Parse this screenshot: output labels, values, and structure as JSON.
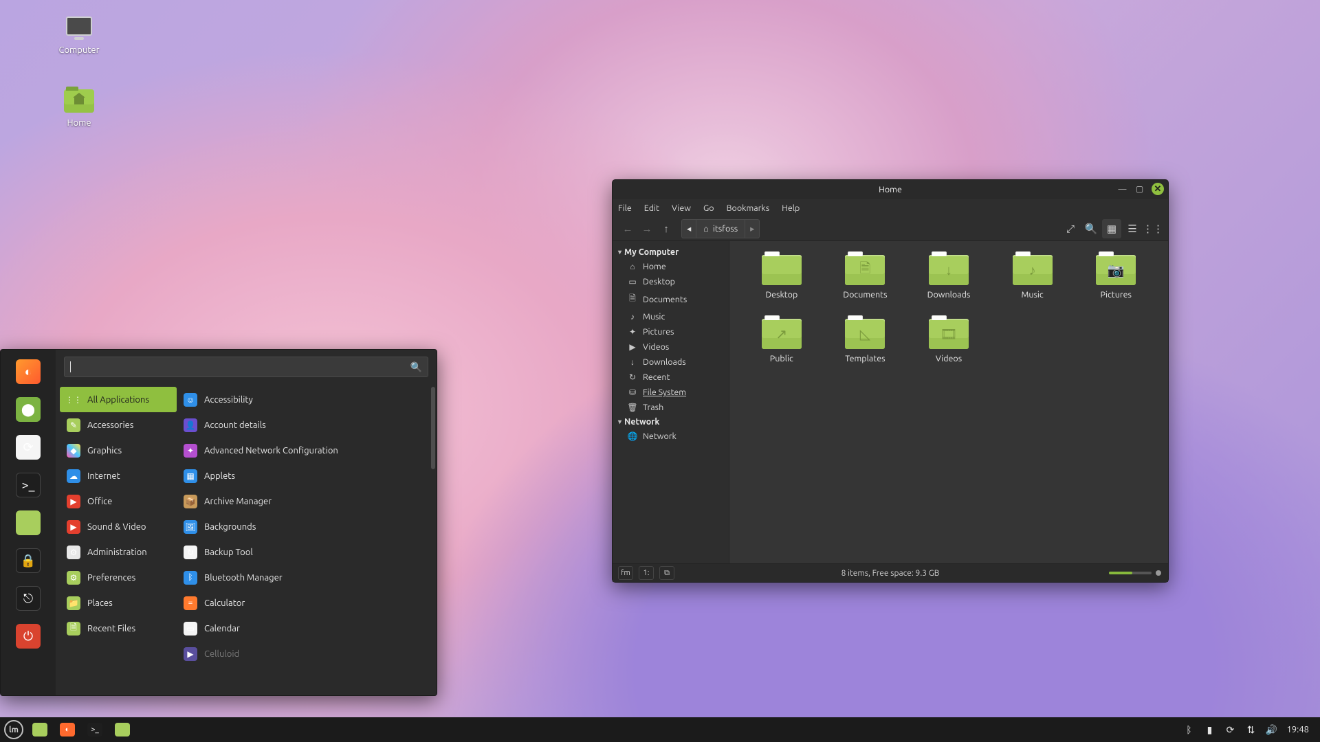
{
  "desktop_icons": {
    "computer": "Computer",
    "home": "Home"
  },
  "file_manager": {
    "title": "Home",
    "menu": [
      "File",
      "Edit",
      "View",
      "Go",
      "Bookmarks",
      "Help"
    ],
    "path_segments": {
      "home_icon": "home",
      "location": "itsfoss"
    },
    "sidebar": {
      "header1": "My Computer",
      "items1": [
        {
          "icon": "⌂",
          "label": "Home"
        },
        {
          "icon": "▭",
          "label": "Desktop"
        },
        {
          "icon": "🗎",
          "label": "Documents"
        },
        {
          "icon": "♪",
          "label": "Music"
        },
        {
          "icon": "✦",
          "label": "Pictures"
        },
        {
          "icon": "▶",
          "label": "Videos"
        },
        {
          "icon": "↓",
          "label": "Downloads"
        },
        {
          "icon": "↻",
          "label": "Recent"
        },
        {
          "icon": "⛁",
          "label": "File System",
          "underline": true
        },
        {
          "icon": "🗑",
          "label": "Trash"
        }
      ],
      "header2": "Network",
      "items2": [
        {
          "icon": "🌐",
          "label": "Network"
        }
      ]
    },
    "folders": [
      {
        "label": "Desktop",
        "glyph": ""
      },
      {
        "label": "Documents",
        "glyph": "🗎"
      },
      {
        "label": "Downloads",
        "glyph": "↓"
      },
      {
        "label": "Music",
        "glyph": "♪"
      },
      {
        "label": "Pictures",
        "glyph": "📷"
      },
      {
        "label": "Public",
        "glyph": "↗"
      },
      {
        "label": "Templates",
        "glyph": "◺"
      },
      {
        "label": "Videos",
        "glyph": "🎞"
      }
    ],
    "status": "8 items, Free space: 9.3 GB",
    "status_buttons": [
      "fm",
      "1:",
      "⧉"
    ]
  },
  "app_menu": {
    "search_placeholder": "",
    "favorites": [
      {
        "name": "firefox",
        "cls": "fav-ff",
        "glyph": "◐"
      },
      {
        "name": "software-manager",
        "cls": "fav-sw",
        "glyph": "⬤"
      },
      {
        "name": "update-manager",
        "cls": "fav-upd",
        "glyph": "⟳"
      },
      {
        "name": "terminal",
        "cls": "fav-term",
        "glyph": ">_"
      },
      {
        "name": "files",
        "cls": "fav-files",
        "glyph": ""
      },
      {
        "name": "lock",
        "cls": "fav-lock",
        "glyph": "🔒"
      },
      {
        "name": "logout",
        "cls": "fav-logout",
        "glyph": "⎋"
      },
      {
        "name": "shutdown",
        "cls": "fav-power",
        "glyph": "⏻"
      }
    ],
    "categories": [
      {
        "icon": "cic-all",
        "glyph": "⋮⋮",
        "label": "All Applications",
        "selected": true
      },
      {
        "icon": "cic-acc",
        "glyph": "✎",
        "label": "Accessories"
      },
      {
        "icon": "cic-gfx",
        "glyph": "◆",
        "label": "Graphics"
      },
      {
        "icon": "cic-net",
        "glyph": "☁",
        "label": "Internet"
      },
      {
        "icon": "cic-off",
        "glyph": "▶",
        "label": "Office"
      },
      {
        "icon": "cic-snd",
        "glyph": "▶",
        "label": "Sound & Video"
      },
      {
        "icon": "cic-adm",
        "glyph": "⚙",
        "label": "Administration"
      },
      {
        "icon": "cic-pref",
        "glyph": "⚙",
        "label": "Preferences"
      },
      {
        "icon": "cic-plc",
        "glyph": "📁",
        "label": "Places"
      },
      {
        "icon": "cic-rec",
        "glyph": "🗎",
        "label": "Recent Files"
      }
    ],
    "applications": [
      {
        "icon": "aic-acc",
        "glyph": "☺",
        "label": "Accessibility"
      },
      {
        "icon": "aic-acct",
        "glyph": "👤",
        "label": "Account details"
      },
      {
        "icon": "aic-net",
        "glyph": "✦",
        "label": "Advanced Network Configuration"
      },
      {
        "icon": "aic-app",
        "glyph": "▦",
        "label": "Applets"
      },
      {
        "icon": "aic-arch",
        "glyph": "📦",
        "label": "Archive Manager"
      },
      {
        "icon": "aic-bg",
        "glyph": "🖼",
        "label": "Backgrounds"
      },
      {
        "icon": "aic-bk",
        "glyph": "↻",
        "label": "Backup Tool"
      },
      {
        "icon": "aic-bt",
        "glyph": "ᛒ",
        "label": "Bluetooth Manager"
      },
      {
        "icon": "aic-calc",
        "glyph": "=",
        "label": "Calculator"
      },
      {
        "icon": "aic-cal",
        "glyph": "▭",
        "label": "Calendar"
      },
      {
        "icon": "aic-cell",
        "glyph": "▶",
        "label": "Celluloid",
        "dim": true
      }
    ]
  },
  "taskbar": {
    "launchers": [
      {
        "name": "menu",
        "glyph": "lm"
      },
      {
        "name": "files",
        "glyph": "",
        "color": "#a8ce5d"
      },
      {
        "name": "firefox",
        "glyph": "◐",
        "color": "#ff6a2e"
      },
      {
        "name": "terminal",
        "glyph": ">_",
        "color": "#1e1e1e"
      },
      {
        "name": "files-window",
        "glyph": "",
        "color": "#a8ce5d"
      }
    ],
    "tray": [
      {
        "name": "bluetooth-icon",
        "glyph": "ᛒ"
      },
      {
        "name": "battery-icon",
        "glyph": "▮"
      },
      {
        "name": "updates-icon",
        "glyph": "⟳"
      },
      {
        "name": "network-icon",
        "glyph": "⇅"
      },
      {
        "name": "volume-icon",
        "glyph": "🔊"
      }
    ],
    "clock": "19:48"
  }
}
